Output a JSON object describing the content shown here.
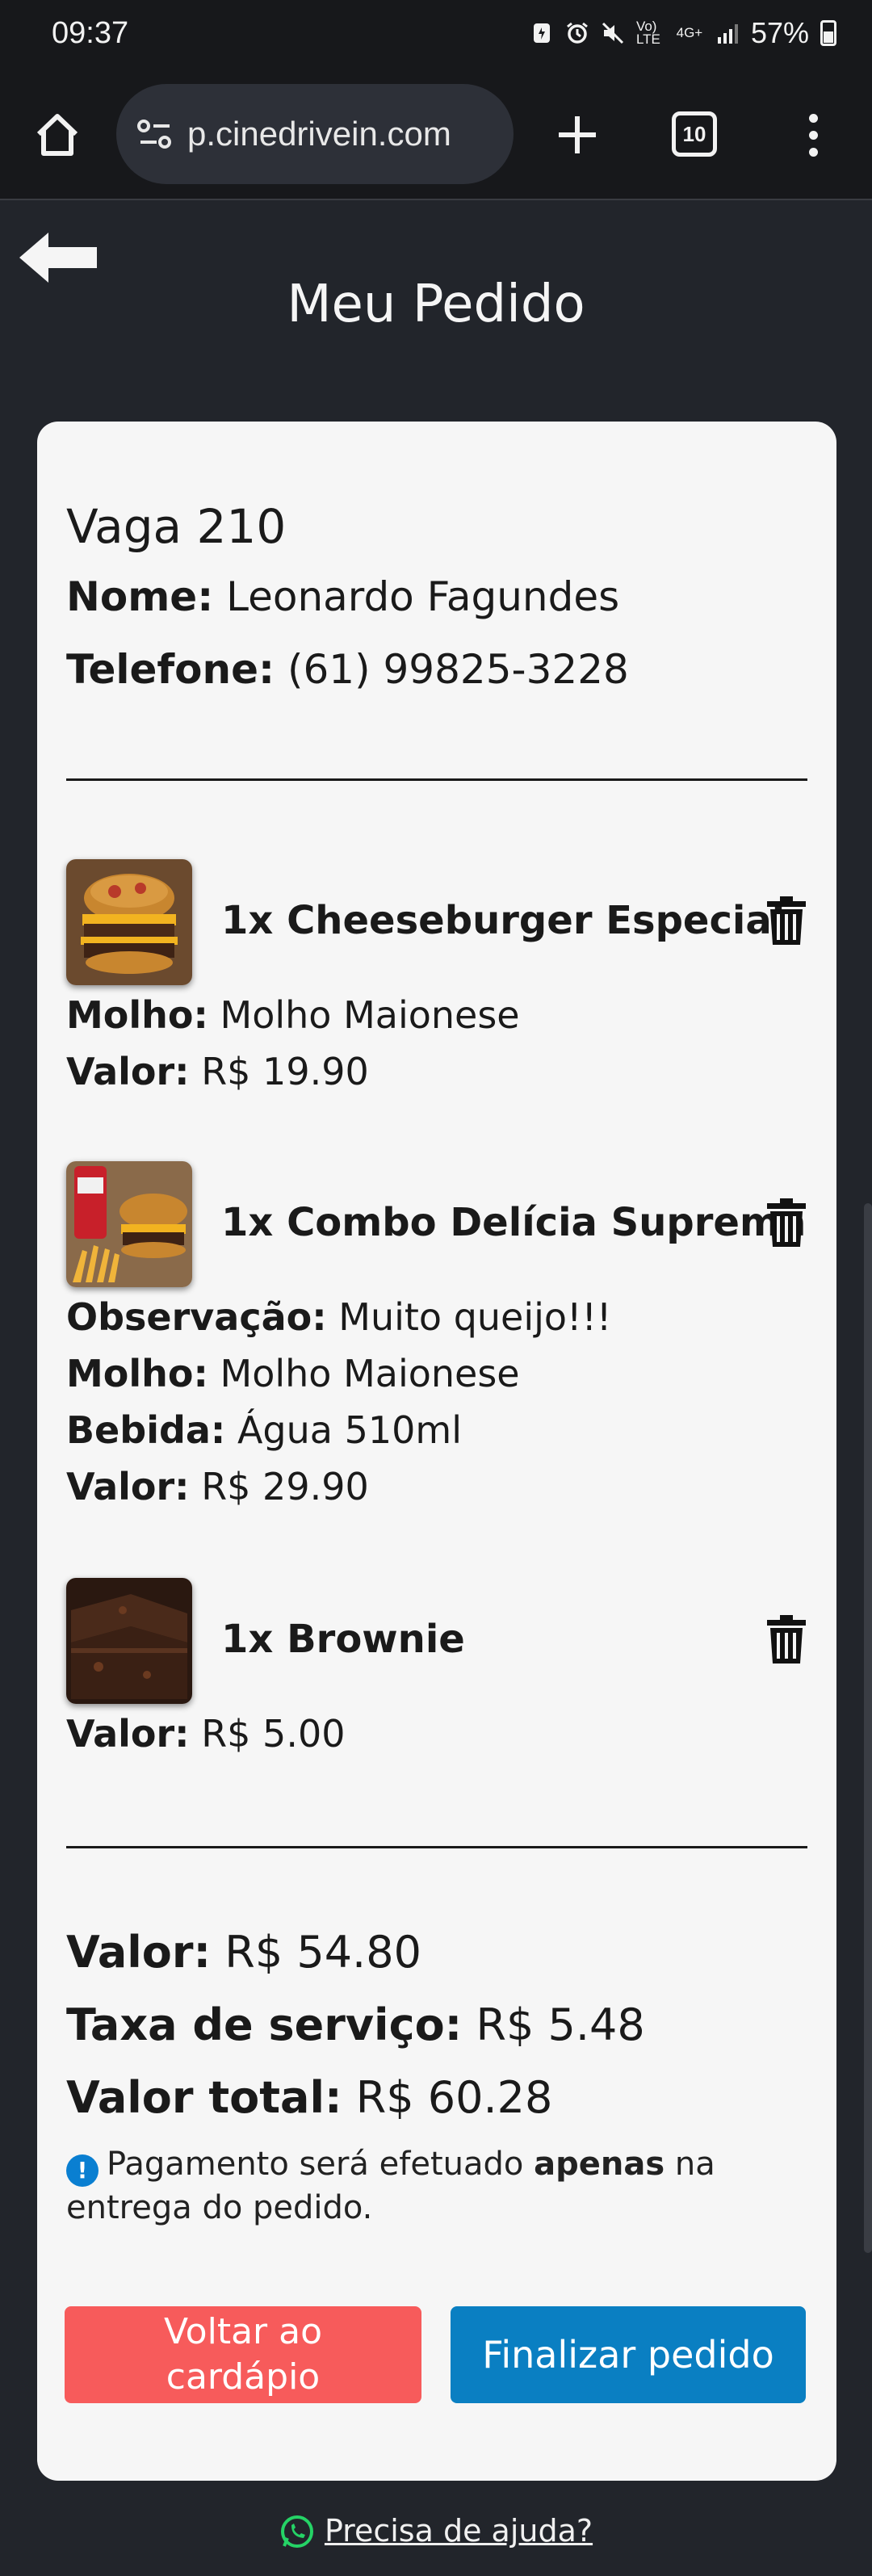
{
  "status_bar": {
    "time": "09:37",
    "battery": "57%",
    "network": "4G+",
    "volte": "Vo) LTE"
  },
  "browser": {
    "url": "p.cinedrivein.com",
    "tab_count": "10"
  },
  "page": {
    "title": "Meu Pedido"
  },
  "order": {
    "spot": "Vaga 210",
    "name_label": "Nome:",
    "name_value": "Leonardo Fagundes",
    "phone_label": "Telefone:",
    "phone_value": "(61) 99825-3228"
  },
  "items": [
    {
      "title": "1x Cheeseburger Especial",
      "image": "burger-image",
      "details": [
        {
          "label": "Molho:",
          "value": "Molho Maionese"
        },
        {
          "label": "Valor:",
          "value": "R$ 19.90"
        }
      ]
    },
    {
      "title": "1x Combo Delícia Suprema",
      "image": "combo-image",
      "details": [
        {
          "label": "Observação:",
          "value": "Muito queijo!!!"
        },
        {
          "label": "Molho:",
          "value": "Molho Maionese"
        },
        {
          "label": "Bebida:",
          "value": "Água 510ml"
        },
        {
          "label": "Valor:",
          "value": "R$ 29.90"
        }
      ]
    },
    {
      "title": "1x Brownie",
      "image": "brownie-image",
      "details": [
        {
          "label": "Valor:",
          "value": "R$ 5.00"
        }
      ]
    }
  ],
  "totals": {
    "subtotal_label": "Valor:",
    "subtotal_value": "R$ 54.80",
    "fee_label": "Taxa de serviço:",
    "fee_value": "R$ 5.48",
    "total_label": "Valor total:",
    "total_value": "R$ 60.28"
  },
  "notice": {
    "before": "Pagamento será efetuado",
    "emphasis": "apenas",
    "after": "na entrega do pedido."
  },
  "buttons": {
    "back_to_menu": "Voltar ao cardápio",
    "finish_order": "Finalizar pedido"
  },
  "help": {
    "label": "Precisa de ajuda?"
  },
  "colors": {
    "background": "#22252b",
    "card": "#f6f6f6",
    "back_button": "#f75b5b",
    "finish_button": "#0a7fc2",
    "info_icon": "#0a7fd1",
    "whatsapp": "#25d366"
  }
}
